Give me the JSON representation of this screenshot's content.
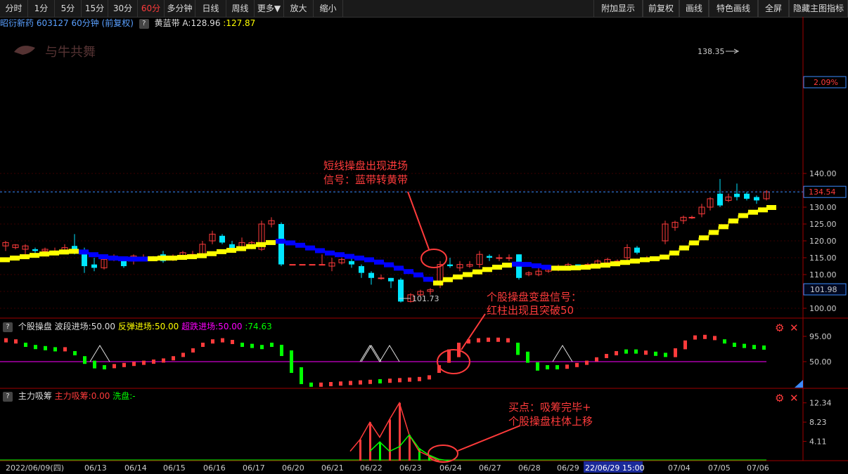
{
  "toolbar": {
    "periods": [
      "分时",
      "1分",
      "5分",
      "15分",
      "30分",
      "60分",
      "多分钟",
      "日线",
      "周线",
      "更多▼",
      "放大",
      "缩小"
    ],
    "active_period": "60分",
    "right_buttons": [
      "附加显示",
      "前复权",
      "画线",
      "特色画线",
      "全屏",
      "隐藏主图指标"
    ]
  },
  "main_header": {
    "title": "昭衍新药 603127 60分钟",
    "fq": "(前复权)",
    "indicator_name": "黄蓝带",
    "a_value": "A:128.96",
    "b_value": ":127.87"
  },
  "watermark": "与牛共舞",
  "main_axis": {
    "ticks": [
      "140.00",
      "135.00",
      "130.00",
      "125.00",
      "120.00",
      "115.00",
      "110.00",
      "105.00",
      "100.00"
    ],
    "price_label": "134.54",
    "pct_label": "2.09%",
    "cursor_price": "101.98",
    "high_label": "138.35",
    "low_label": "101.73"
  },
  "annotations": {
    "main_note": [
      "短线操盘出现进场",
      "信号：蓝带转黄带"
    ],
    "sub1_note": [
      "个股操盘变盘信号：",
      "红柱出现且突破50"
    ],
    "sub2_note": [
      "买点：吸筹完毕+",
      "个股操盘柱体上移"
    ]
  },
  "sub1_header": {
    "name": "个股操盘",
    "a": "波段进场:50.00",
    "b": "反弹进场:50.00",
    "c": "超跌进场:50.00",
    "d": ":74.63",
    "ticks": [
      "95.00",
      "50.00"
    ]
  },
  "sub2_header": {
    "name": "主力吸筹",
    "a": "主力吸筹:0.00",
    "b": "洗盘:-",
    "ticks": [
      "12.34",
      "8.23",
      "4.11"
    ]
  },
  "xaxis": [
    "2022/06/09(四)",
    "06/13",
    "06/14",
    "06/15",
    "06/16",
    "06/17",
    "06/20",
    "06/21",
    "06/22",
    "06/23",
    "06/24",
    "06/27",
    "06/28",
    "06/29",
    "22/06/29 15:00",
    "07/04",
    "07/05",
    "07/06"
  ],
  "colors": {
    "up": "#ff3b3b",
    "down": "#00e5ff",
    "yellow": "#ffff00",
    "blue": "#0000ff",
    "green": "#00ff00",
    "magenta": "#ff00ff",
    "grid": "#a00000"
  }
}
